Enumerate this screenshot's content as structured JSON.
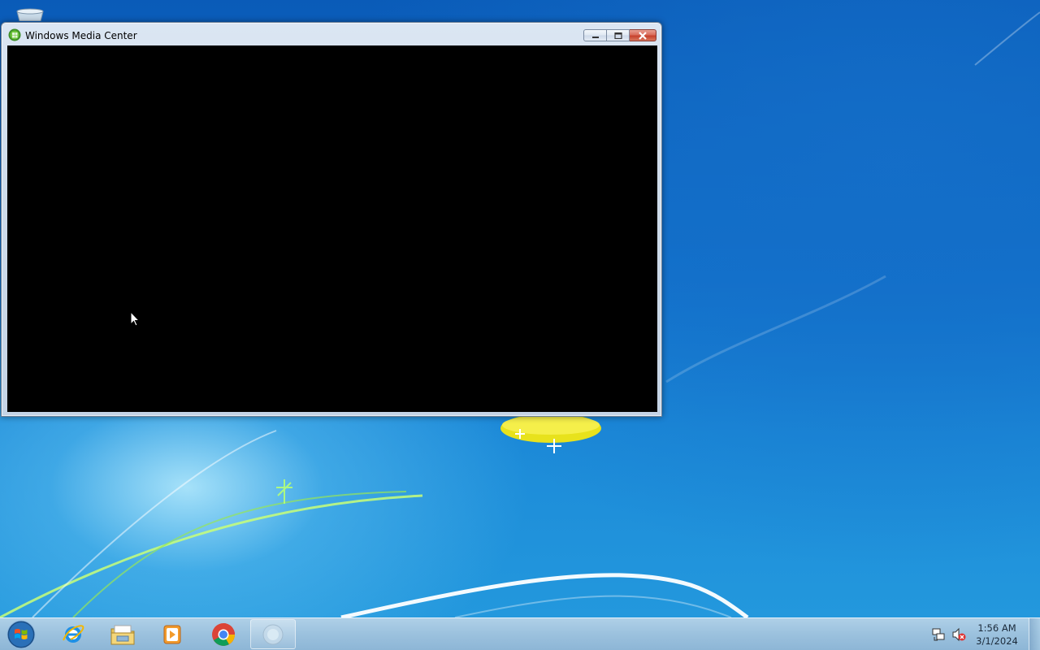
{
  "window": {
    "title": "Windows Media Center",
    "icons": {
      "app": "windows-media-center-icon",
      "minimize": "minimize-icon",
      "maximize": "maximize-icon",
      "close": "close-icon"
    }
  },
  "desktop": {
    "icons": [
      "recycle-bin-icon"
    ]
  },
  "taskbar": {
    "start": "windows-start-icon",
    "pinned": [
      {
        "name": "internet-explorer",
        "icon": "internet-explorer-icon"
      },
      {
        "name": "windows-explorer",
        "icon": "folder-icon"
      },
      {
        "name": "windows-media-player",
        "icon": "media-player-icon"
      },
      {
        "name": "google-chrome",
        "icon": "chrome-icon"
      },
      {
        "name": "windows-media-center",
        "icon": "windows-media-center-icon",
        "active": true
      }
    ],
    "tray": {
      "icons": [
        "network-icon",
        "volume-muted-icon"
      ],
      "time": "1:56 AM",
      "date": "3/1/2024"
    }
  }
}
